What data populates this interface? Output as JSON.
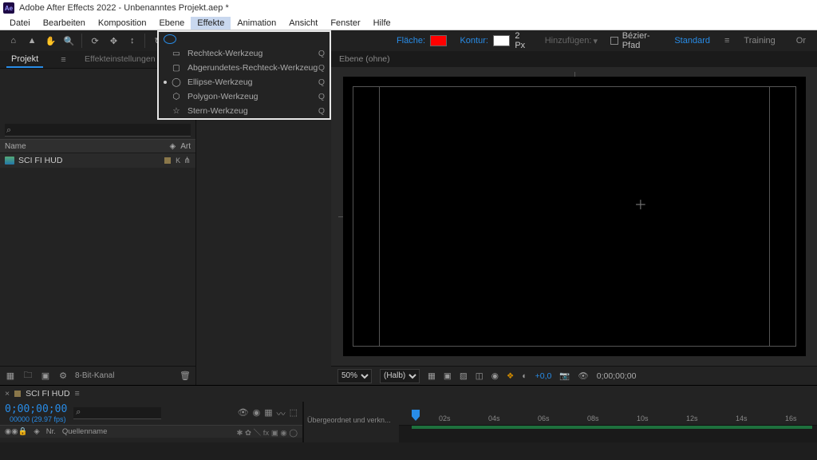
{
  "title": "Adobe After Effects 2022 - Unbenanntes Projekt.aep *",
  "logo": "Ae",
  "menu": {
    "items": [
      "Datei",
      "Bearbeiten",
      "Komposition",
      "Ebene",
      "Effekte",
      "Animation",
      "Ansicht",
      "Fenster",
      "Hilfe"
    ],
    "selected": 4
  },
  "toolbar": {
    "fill_label": "Fläche:",
    "stroke_label": "Kontur:",
    "stroke_px": "2 Px",
    "add_label": "Hinzufügen:",
    "bezier_label": "Bézier-Pfad",
    "workspace_tabs": [
      "Standard",
      "Training",
      "Or"
    ]
  },
  "shape_menu": {
    "items": [
      {
        "label": "Rechteck-Werkzeug",
        "shortcut": "Q",
        "shape": "rect"
      },
      {
        "label": "Abgerundetes-Rechteck-Werkzeug",
        "shortcut": "Q",
        "shape": "roundrect"
      },
      {
        "label": "Ellipse-Werkzeug",
        "shortcut": "Q",
        "shape": "ellipse",
        "selected": true
      },
      {
        "label": "Polygon-Werkzeug",
        "shortcut": "Q",
        "shape": "polygon"
      },
      {
        "label": "Stern-Werkzeug",
        "shortcut": "Q",
        "shape": "star"
      }
    ]
  },
  "panels": {
    "project_tab": "Projekt",
    "fx_tab": "Effekteinstellungen (ohne)"
  },
  "project": {
    "col_name": "Name",
    "col_type": "Art",
    "item_name": "SCI FI HUD",
    "item_tag": "K",
    "footer_depth": "8-Bit-Kanal"
  },
  "viewer": {
    "tab": "Ebene (ohne)",
    "zoom": "50%",
    "res": "(Halb)",
    "exposure": "+0,0",
    "timecode": "0;00;00;00"
  },
  "timeline": {
    "comp_name": "SCI FI HUD",
    "timecode": "0;00;00;00",
    "fps": "00000 (29.97 fps)",
    "col_num": "Nr.",
    "col_src": "Quellenname",
    "parent": "Übergeordnet und verkn...",
    "marks": [
      "02s",
      "04s",
      "06s",
      "08s",
      "10s",
      "12s",
      "14s",
      "16s"
    ]
  }
}
